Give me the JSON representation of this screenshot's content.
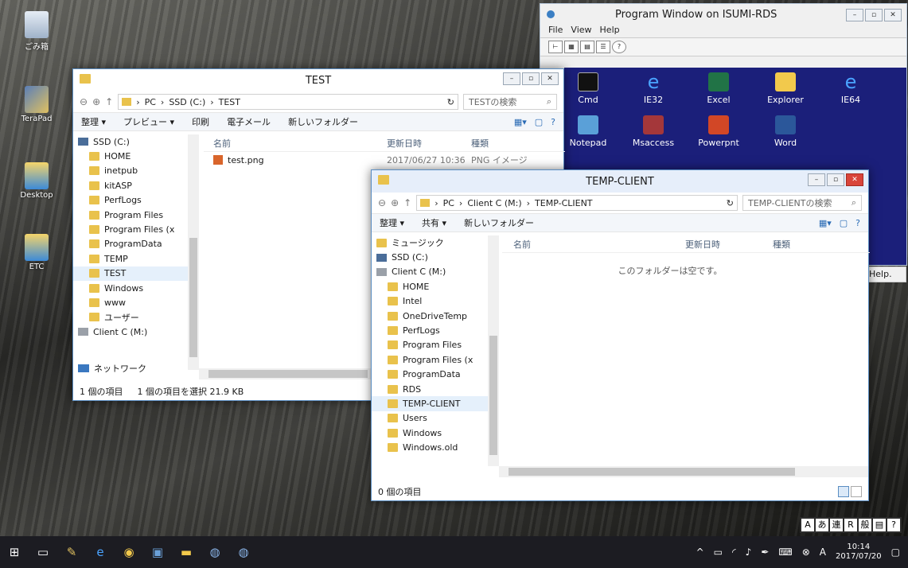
{
  "desktop": {
    "icons": [
      {
        "label": "ごみ箱"
      },
      {
        "label": "TeraPad"
      },
      {
        "label": "Desktop"
      },
      {
        "label": "ETC"
      }
    ]
  },
  "rds_window": {
    "title": "Program Window on ISUMI-RDS",
    "menu": [
      "File",
      "View",
      "Help"
    ],
    "apps_row1": [
      "Cmd",
      "IE32",
      "Excel",
      "Explorer",
      "IE64"
    ],
    "apps_row2": [
      "Notepad",
      "Msaccess",
      "Powerpnt",
      "Word"
    ],
    "help_fragment": "Help."
  },
  "test_window": {
    "title": "TEST",
    "breadcrumb": [
      "PC",
      "SSD (C:)",
      "TEST"
    ],
    "search_placeholder": "TESTの検索",
    "commands": [
      "整理 ▾",
      "プレビュー ▾",
      "印刷",
      "電子メール",
      "新しいフォルダー"
    ],
    "tree": [
      {
        "label": "SSD (C:)",
        "type": "drive",
        "top": true
      },
      {
        "label": "HOME"
      },
      {
        "label": "inetpub"
      },
      {
        "label": "kitASP"
      },
      {
        "label": "PerfLogs"
      },
      {
        "label": "Program Files"
      },
      {
        "label": "Program Files (x"
      },
      {
        "label": "ProgramData"
      },
      {
        "label": "TEMP"
      },
      {
        "label": "TEST",
        "selected": true
      },
      {
        "label": "Windows"
      },
      {
        "label": "www"
      },
      {
        "label": "ユーザー"
      },
      {
        "label": "Client C (M:)",
        "type": "disk",
        "top": true
      }
    ],
    "network": "ネットワーク",
    "columns": [
      "名前",
      "更新日時",
      "種類"
    ],
    "files": [
      {
        "name": "test.png",
        "date": "2017/06/27 10:36",
        "type": "PNG イメージ"
      }
    ],
    "status_items": "1 個の項目",
    "status_selected": "1 個の項目を選択 21.9 KB"
  },
  "temp_window": {
    "title": "TEMP-CLIENT",
    "breadcrumb": [
      "PC",
      "Client C (M:)",
      "TEMP-CLIENT"
    ],
    "search_placeholder": "TEMP-CLIENTの検索",
    "commands": [
      "整理 ▾",
      "共有 ▾",
      "新しいフォルダー"
    ],
    "tree": [
      {
        "label": "ミュージック",
        "top": true
      },
      {
        "label": "SSD (C:)",
        "type": "drive",
        "top": true
      },
      {
        "label": "Client C (M:)",
        "type": "disk",
        "top": true
      },
      {
        "label": "HOME"
      },
      {
        "label": "Intel"
      },
      {
        "label": "OneDriveTemp"
      },
      {
        "label": "PerfLogs"
      },
      {
        "label": "Program Files"
      },
      {
        "label": "Program Files (x"
      },
      {
        "label": "ProgramData"
      },
      {
        "label": "RDS"
      },
      {
        "label": "TEMP-CLIENT",
        "selected": true
      },
      {
        "label": "Users"
      },
      {
        "label": "Windows"
      },
      {
        "label": "Windows.old"
      }
    ],
    "columns": [
      "名前",
      "更新日時",
      "種類"
    ],
    "empty_message": "このフォルダーは空です。",
    "status_items": "0 個の項目"
  },
  "taskbar": {
    "time": "10:14",
    "date": "2017/07/20",
    "ime": [
      "A",
      "あ",
      "連",
      "R",
      "般",
      "▤",
      "?"
    ]
  }
}
